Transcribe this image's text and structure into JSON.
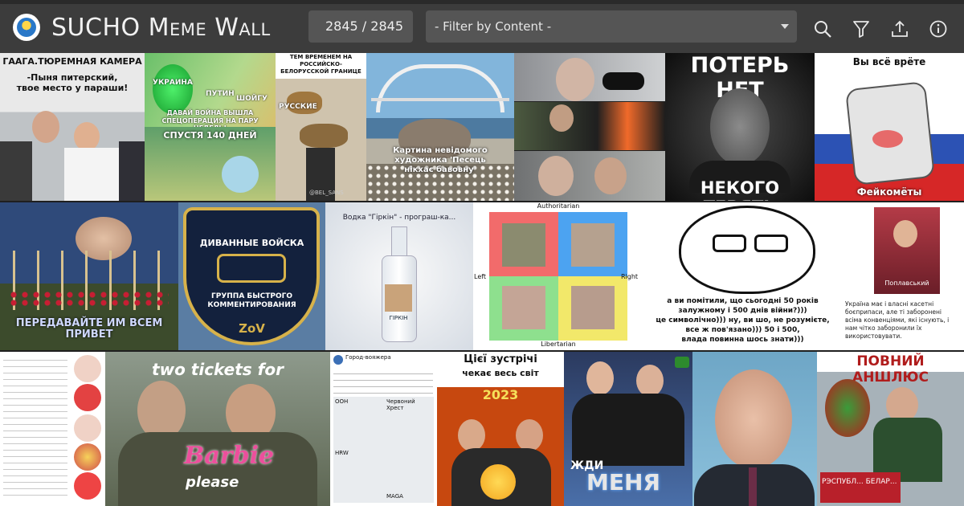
{
  "header": {
    "title": "SUCHO Meme Wall",
    "counter": "2845 / 2845",
    "filter": {
      "placeholder": "- Filter by Content -",
      "selected": "- Filter by Content -"
    },
    "icons": [
      "logo-icon",
      "search-icon",
      "filter-icon",
      "upload-icon",
      "info-icon"
    ]
  },
  "tiles": {
    "t1": {
      "lines": [
        "ГААГА.ТЮРЕМНАЯ КАМЕРА",
        "-Пыня питерский,",
        "твое место у параши!"
      ]
    },
    "t2": {
      "top": [
        "УКРАИНА",
        "ПУТИН",
        "ШОЙГУ",
        "ДАВАЙ ВОЙНА ВЫШЛА",
        "СПЕЦОПЕРАЦИЯ НА ПАРУ НЕДЕЛЬ!"
      ],
      "bottom": "СПУСТЯ 140 ДНЕЙ"
    },
    "t3": {
      "top": "ТЕМ ВРЕМЕНЕМ НА РОССИЙСКО-БЕЛОРУССКОЙ ГРАНИЦЕ",
      "label": "РУССКИЕ",
      "credit": "@BEL_SANS"
    },
    "t4": {
      "caption": "Картина невідомого художника 'Песець нікхає бавовну'"
    },
    "t6": {
      "top": "ПОТЕРЬ НЕТ",
      "bottom": "НЕКОГО ТЕРЯТЬ"
    },
    "t7": {
      "top": "Вы всё врёте",
      "bottom": "Фейкомёты"
    },
    "t8": {
      "caption": "ПЕРЕДАВАЙТЕ ИМ ВСЕМ ПРИВЕТ"
    },
    "t9": {
      "top": "ДИВАННЫЕ ВОЙСКА",
      "middle": "ГРУППА БЫСТРОГО КОММЕНТИРОВАНИЯ",
      "bottom": "ZoV"
    },
    "t10": {
      "text": "Водка \"Гіркін\" - програш-ка...",
      "label": "ГІРКІН"
    },
    "t11": {
      "top": "Authoritarian",
      "left": "Left",
      "right": "Right",
      "bottom": "Libertarian"
    },
    "t12": {
      "lines": [
        "а ви помітили, що сьогодні 50 років",
        "залужному і 500 днів війни?)))",
        "це символічно))) ну, ви шо, не розумієте,",
        "все ж пов'язано))) 50 і 500,",
        "влада повинна шось знати)))"
      ]
    },
    "t13": {
      "label": "Поплавський",
      "text": [
        "Україна має і власні касетні",
        "боєприпаси, але ті заборонені",
        "всіма конвенціями, які існують, і",
        "нам чітко заборонили їх",
        "використовувати."
      ]
    },
    "t15": {
      "top": "two tickets for",
      "brand": "Barbie",
      "bottom": "please"
    },
    "t16": {
      "user": "Город-вояжера",
      "labels": [
        "ООН",
        "Червоний Хрест",
        "HRW",
        "MAGA"
      ]
    },
    "t17": {
      "top": [
        "Цієї зустрічі",
        "чекає весь світ"
      ],
      "year": "2023"
    },
    "t18": {
      "top": "ЖДИ",
      "bottom": "МЕНЯ"
    },
    "t20": {
      "top": "ПОВНИЙ АНШЛЮС",
      "sign": "РЭСПУБЛ... БЕЛАР..."
    }
  },
  "colors": {
    "topbar": "#3c3c3c",
    "field": "#555555",
    "text": "#f1f1f1",
    "background": "#1f1f1f"
  }
}
